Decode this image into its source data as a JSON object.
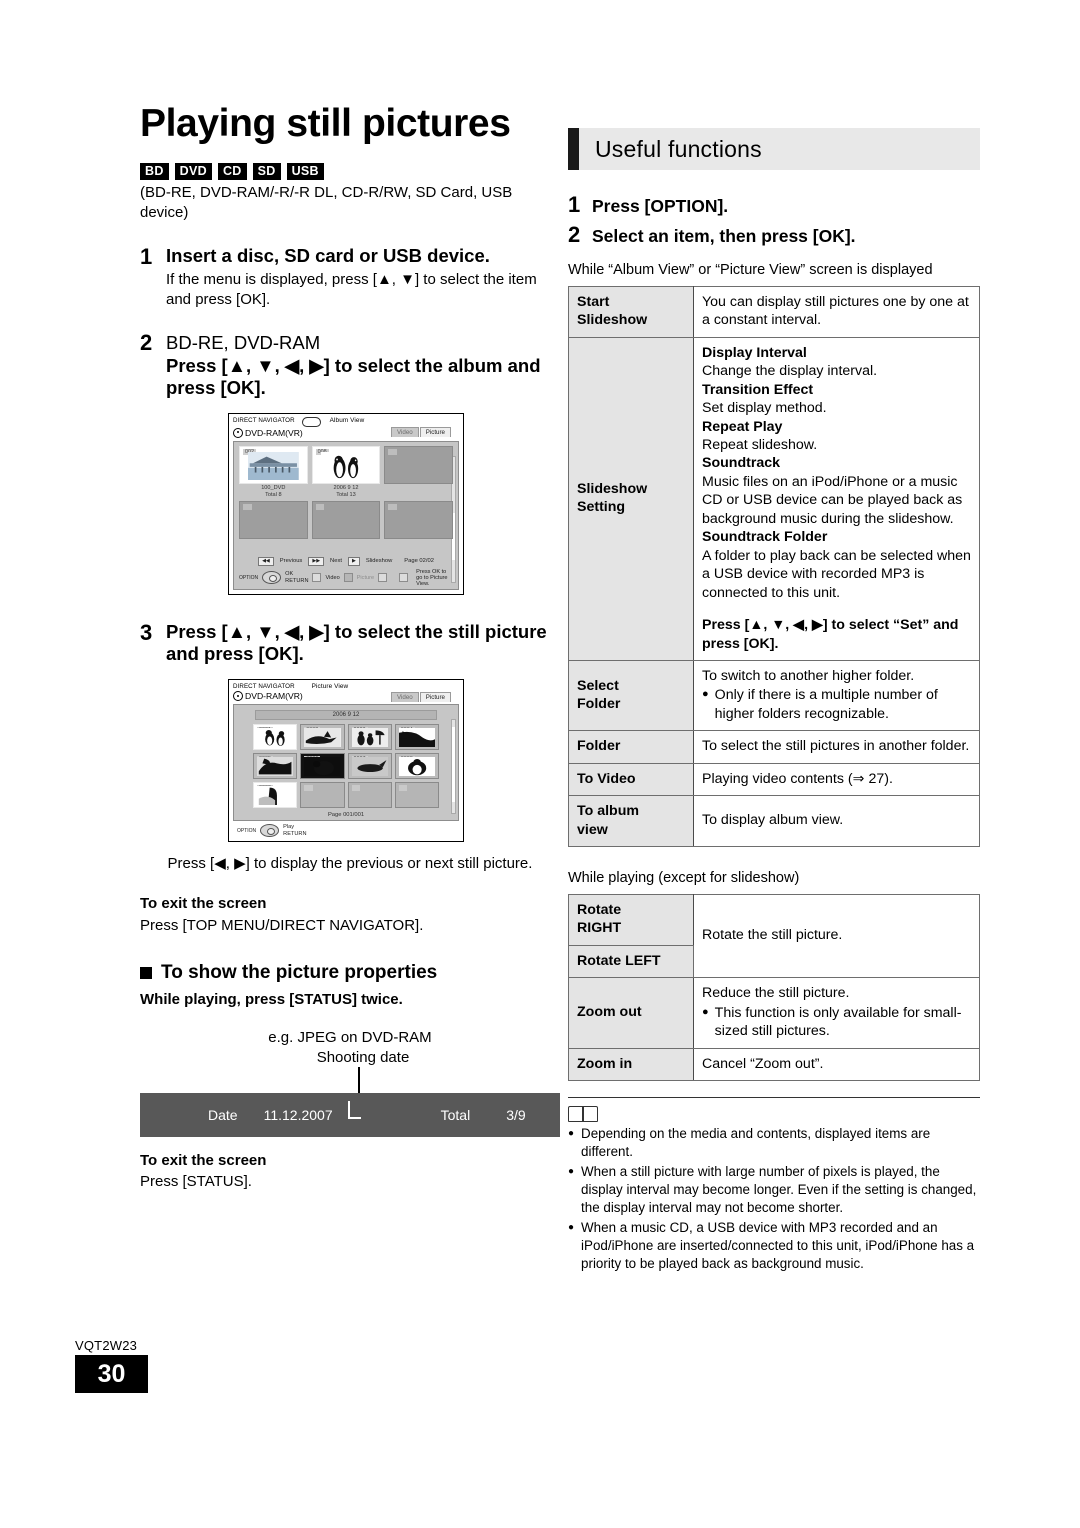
{
  "footer": {
    "doc_code": "VQT2W23",
    "page_number": "30"
  },
  "left": {
    "title": "Playing still pictures",
    "badges": [
      "BD",
      "DVD",
      "CD",
      "SD",
      "USB"
    ],
    "media_note": "(BD-RE, DVD-RAM/-R/-R DL, CD-R/RW, SD Card, USB device)",
    "steps": [
      {
        "num": "1",
        "head": "Insert a disc, SD card or USB device.",
        "sub": "If the menu is displayed, press [▲, ▼] to select the item and press [OK]."
      },
      {
        "num": "2",
        "head_plain": "BD-RE, DVD-RAM",
        "head": "Press [▲, ▼, ◀, ▶] to select the album and press [OK]."
      },
      {
        "num": "3",
        "head": "Press [▲, ▼, ◀, ▶] to select the still picture and press [OK]."
      }
    ],
    "shot_album": {
      "title": "DIRECT NAVIGATOR",
      "view": "Album View",
      "disc": "DVD-RAM(VR)",
      "tabs": [
        "Video",
        "Picture"
      ],
      "active_tab": "Picture",
      "albums": [
        {
          "num": "002",
          "caption1": "100_DVD",
          "caption2": "Total 8"
        },
        {
          "num": "008",
          "caption1": "2006 9 12",
          "caption2": "Total 13"
        }
      ],
      "foot": {
        "previous": "Previous",
        "next": "Next",
        "slideshow": "Slideshow",
        "page": "Page 02/02",
        "ok": "OK",
        "return": "RETURN",
        "option": "OPTION",
        "video": "Video",
        "picture": "Picture",
        "hint": "Press OK to go to Picture View."
      }
    },
    "shot_picture": {
      "title": "DIRECT NAVIGATOR",
      "view": "Picture View",
      "disc": "DVD-RAM(VR)",
      "tabs": [
        "Video",
        "Picture"
      ],
      "active_tab": "Picture",
      "album_label": "2006 9 12",
      "thumb_numbers": [
        "0001",
        "0002",
        "0003",
        "0004",
        "0005",
        "0006",
        "0007",
        "0008",
        "0009"
      ],
      "page": "Page  001/001",
      "play": "Play",
      "return": "RETURN",
      "option": "OPTION"
    },
    "after_shot_note": "Press [◀, ▶] to display the previous or next still picture.",
    "exit1_head": "To exit the screen",
    "exit1_body": "Press [TOP MENU/DIRECT NAVIGATOR].",
    "props_head": "To show the picture properties",
    "props_sub": "While playing, press [STATUS] twice.",
    "eg_line1": "e.g. JPEG on DVD-RAM",
    "eg_line2": "Shooting date",
    "statusbar": {
      "date_label": "Date",
      "date_value": "11.12.2007",
      "total_label": "Total",
      "total_value": "3/9"
    },
    "exit2_head": "To exit the screen",
    "exit2_body": "Press [STATUS]."
  },
  "right": {
    "header_title": "Useful functions",
    "steps": [
      {
        "num": "1",
        "text": "Press [OPTION]."
      },
      {
        "num": "2",
        "text": "Select an item, then press [OK]."
      }
    ],
    "caption1": "While “Album View” or “Picture View” screen is displayed",
    "caption2": "While playing (except for slideshow)",
    "table1": [
      {
        "key": "Start\nSlideshow",
        "lines": [
          {
            "type": "text",
            "text": "You can display still pictures one by one at a constant interval."
          }
        ]
      },
      {
        "key": "Slideshow\nSetting",
        "lines": [
          {
            "type": "bold",
            "text": "Display Interval"
          },
          {
            "type": "text",
            "text": "Change the display interval."
          },
          {
            "type": "bold",
            "text": "Transition Effect"
          },
          {
            "type": "text",
            "text": "Set display method."
          },
          {
            "type": "bold",
            "text": "Repeat Play"
          },
          {
            "type": "text",
            "text": "Repeat slideshow."
          },
          {
            "type": "bold",
            "text": "Soundtrack"
          },
          {
            "type": "text",
            "text": "Music files on an iPod/iPhone or a music CD or USB device can be played back as background music during the slideshow."
          },
          {
            "type": "bold",
            "text": "Soundtrack Folder"
          },
          {
            "type": "text",
            "text": "A folder to play back can be selected when a USB device with recorded MP3 is connected to this unit."
          }
        ],
        "footer_bold": "Press [▲, ▼, ◀, ▶] to select “Set” and press [OK]."
      },
      {
        "key": "Select\nFolder",
        "lines": [
          {
            "type": "text",
            "text": "To switch to another higher folder."
          },
          {
            "type": "bullet",
            "text": "Only if there is a multiple number of higher folders recognizable."
          }
        ]
      },
      {
        "key": "Folder",
        "lines": [
          {
            "type": "text",
            "text": "To select the still pictures in another folder."
          }
        ]
      },
      {
        "key": "To Video",
        "lines": [
          {
            "type": "text",
            "text": "Playing video contents (⇒ 27)."
          }
        ]
      },
      {
        "key": "To album\nview",
        "lines": [
          {
            "type": "text",
            "text": "To display album view."
          }
        ]
      }
    ],
    "table2": {
      "rotate_keys": [
        "Rotate\nRIGHT",
        "Rotate LEFT"
      ],
      "rotate_value": "Rotate the still picture.",
      "zoom_out_key": "Zoom out",
      "zoom_out_lines": [
        {
          "type": "text",
          "text": "Reduce the still picture."
        },
        {
          "type": "bullet",
          "text": "This function is only available for small-sized still pictures."
        }
      ],
      "zoom_in_key": "Zoom in",
      "zoom_in_value": "Cancel “Zoom out”."
    },
    "notes": [
      "Depending on the media and contents, displayed items are different.",
      "When a still picture with large number of pixels is played, the display interval may become longer. Even if the setting is changed, the display interval may not become shorter.",
      "When a music CD, a USB device with MP3 recorded and an iPod/iPhone are inserted/connected to this unit, iPod/iPhone has a priority to be played back as background music."
    ]
  }
}
